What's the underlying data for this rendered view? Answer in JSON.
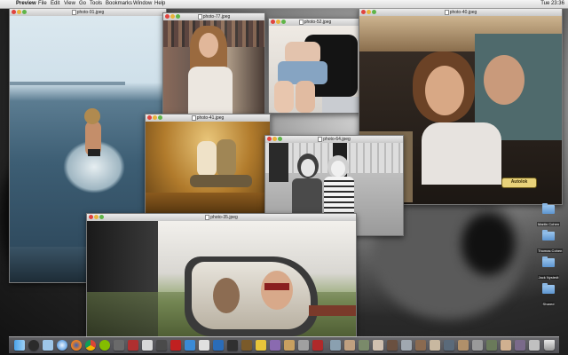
{
  "menubar": {
    "app": "Preview",
    "items": [
      "File",
      "Edit",
      "View",
      "Go",
      "Tools",
      "Bookmarks",
      "Window",
      "Help"
    ],
    "clock": "Tue 23:36"
  },
  "windows": [
    {
      "title": "photo-91.jpeg"
    },
    {
      "title": "photo-77.jpeg"
    },
    {
      "title": "photo-52.jpeg"
    },
    {
      "title": "photo-40.jpeg"
    },
    {
      "title": "photo-41.jpeg"
    },
    {
      "title": "photo-64.jpeg"
    },
    {
      "title": "photo-35.jpeg"
    }
  ],
  "sticker": {
    "text": "Autolok"
  },
  "desktop_folders": [
    {
      "label": "Martin Cohen"
    },
    {
      "label": "Thomas Cohen"
    },
    {
      "label": "Jack Nystedt"
    },
    {
      "label": "Shared"
    }
  ],
  "colors": {
    "accent": "#5d95cf",
    "close": "#e0443e",
    "minimize": "#e9b33b",
    "zoom": "#5fb548"
  }
}
